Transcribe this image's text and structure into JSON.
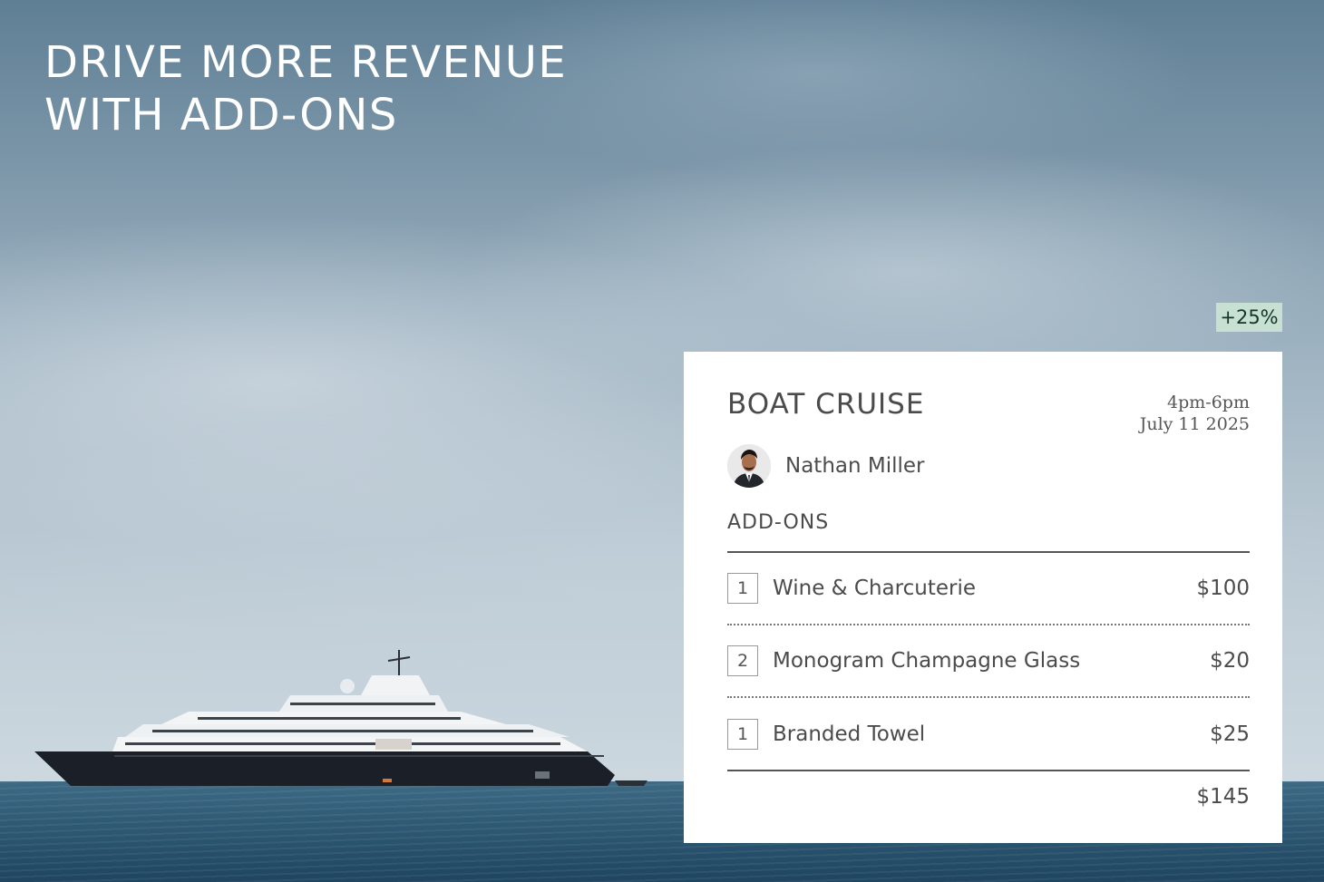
{
  "headline": {
    "line1": "DRIVE MORE REVENUE",
    "line2": "WITH ADD-ONS"
  },
  "badge": "+25%",
  "card": {
    "title": "BOAT CRUISE",
    "time": "4pm-6pm",
    "date": "July 11 2025",
    "host_name": "Nathan Miller",
    "section_label": "ADD-ONS",
    "items": [
      {
        "qty": "1",
        "name": "Wine & Charcuterie",
        "price": "$100"
      },
      {
        "qty": "2",
        "name": "Monogram Champagne Glass",
        "price": "$20"
      },
      {
        "qty": "1",
        "name": "Branded Towel",
        "price": "$25"
      }
    ],
    "total": "$145"
  },
  "colors": {
    "badge_bg": "#c7e0d2",
    "card_bg": "#ffffff",
    "text": "#4b4b4b"
  },
  "icons": {
    "avatar": "person-avatar",
    "background": "cruise-ship-photo"
  }
}
